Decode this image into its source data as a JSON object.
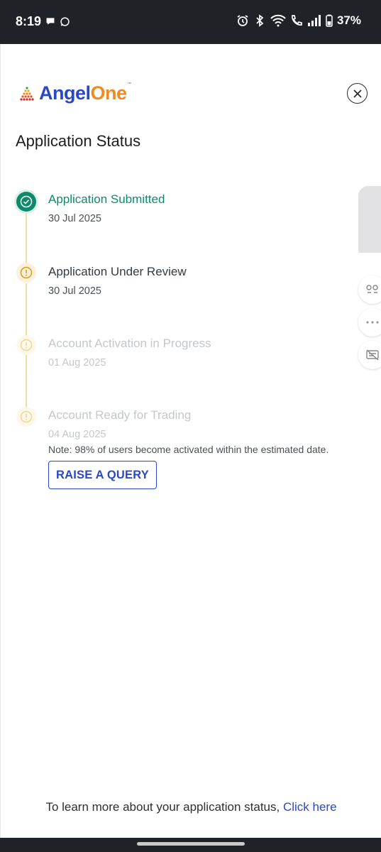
{
  "status_bar": {
    "time": "8:19",
    "battery": "37%",
    "left_icons": [
      "chat-bubble-icon",
      "whatsapp-icon"
    ],
    "right_icons": [
      "alarm-icon",
      "bluetooth-icon",
      "wifi-icon",
      "wifi-call-icon",
      "signal-icon",
      "battery-icon"
    ]
  },
  "logo": {
    "part1": "Angel",
    "part2": "One",
    "tm": "™"
  },
  "page_title": "Application Status",
  "timeline": [
    {
      "title": "Application Submitted",
      "date": "30 Jul 2025",
      "state": "done"
    },
    {
      "title": "Application Under Review",
      "date": "30 Jul 2025",
      "state": "active"
    },
    {
      "title": "Account Activation in Progress",
      "date": "01 Aug 2025",
      "state": "pending"
    },
    {
      "title": "Account Ready for Trading",
      "date": "04 Aug 2025",
      "state": "pending"
    }
  ],
  "note": "Note: 98% of users become activated within the estimated date.",
  "query_button": "RAISE A QUERY",
  "footer": {
    "text": "To learn more about your application status, ",
    "link": "Click here"
  },
  "colors": {
    "brand_blue": "#2b48c4",
    "brand_orange": "#f08a24",
    "success": "#0d8a6c",
    "warning": "#e0a32a"
  }
}
